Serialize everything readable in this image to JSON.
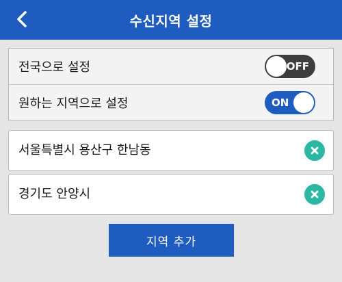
{
  "header": {
    "title": "수신지역 설정",
    "back_icon": "chevron-left-icon"
  },
  "settings": {
    "nationwide": {
      "label": "전국으로 설정",
      "toggle_state": "OFF"
    },
    "custom_region": {
      "label": "원하는 지역으로 설정",
      "toggle_state": "ON"
    }
  },
  "regions": [
    {
      "label": "서울특별시 용산구 한남동",
      "remove_icon": "close-circle-icon"
    },
    {
      "label": "경기도 안양시",
      "remove_icon": "close-circle-icon"
    }
  ],
  "add_button_label": "지역 추가",
  "colors": {
    "primary": "#1f5cbf",
    "toggle_off": "#3d3d3d",
    "remove_accent": "#2bb7a3",
    "background": "#e5e5e5"
  }
}
